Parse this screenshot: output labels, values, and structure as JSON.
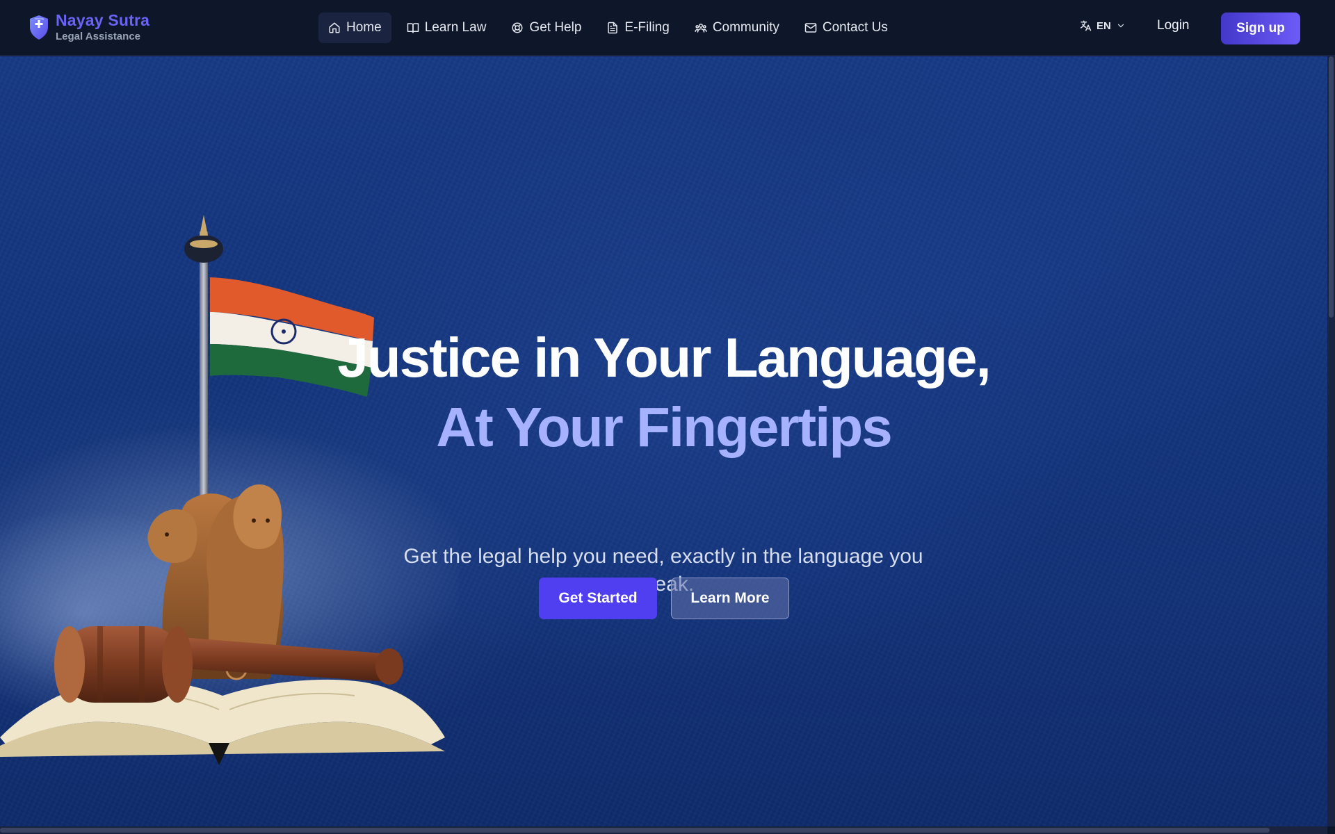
{
  "brand": {
    "name": "Nayay Sutra",
    "tagline": "Legal Assistance",
    "icon": "shield-plus-icon",
    "color": "#6b63f5"
  },
  "nav": {
    "items": [
      {
        "label": "Home",
        "icon": "home-icon",
        "active": true
      },
      {
        "label": "Learn Law",
        "icon": "book-open-icon",
        "active": false
      },
      {
        "label": "Get Help",
        "icon": "lifebuoy-icon",
        "active": false
      },
      {
        "label": "E-Filing",
        "icon": "file-text-icon",
        "active": false
      },
      {
        "label": "Community",
        "icon": "users-icon",
        "active": false
      },
      {
        "label": "Contact Us",
        "icon": "mail-icon",
        "active": false
      }
    ],
    "language": {
      "label": "EN",
      "icon": "languages-icon"
    },
    "login_label": "Login",
    "signup_label": "Sign up"
  },
  "hero": {
    "headline_line1": "Justice in Your Language,",
    "headline_line2": "At Your Fingertips",
    "subtitle": "Get the legal help you need, exactly in the language you speak.",
    "primary_button": "Get Started",
    "secondary_button": "Learn More",
    "accent_color": "#a7b2ff",
    "primary_color": "#4f3ff0"
  }
}
